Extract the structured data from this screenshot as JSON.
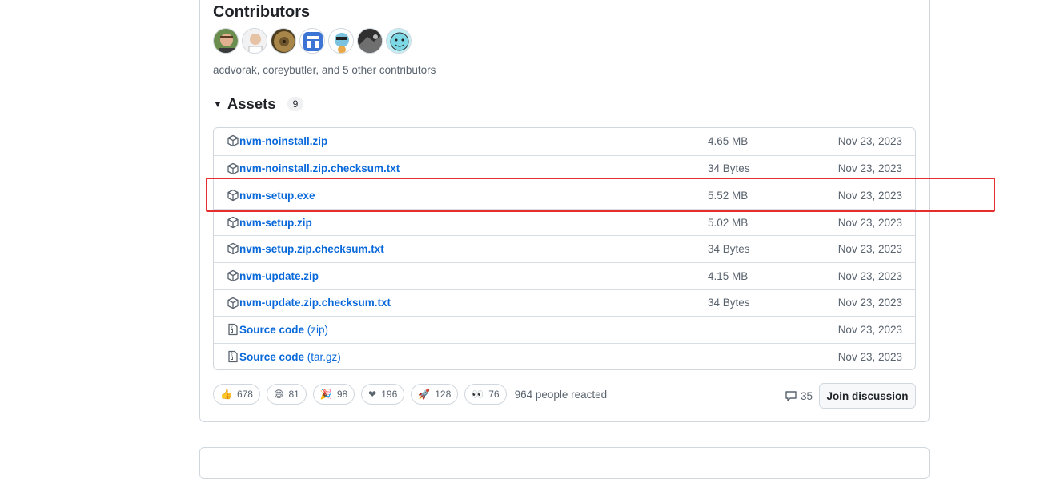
{
  "contributors": {
    "title": "Contributors",
    "text": "acdvorak, coreybutler, and 5 other contributors",
    "avatars": [
      {
        "name": "acdvorak"
      },
      {
        "name": "coreybutler"
      },
      {
        "name": "contributor-3"
      },
      {
        "name": "contributor-4"
      },
      {
        "name": "contributor-5"
      },
      {
        "name": "contributor-6"
      },
      {
        "name": "contributor-7"
      }
    ]
  },
  "assets": {
    "title": "Assets",
    "count": "9",
    "rows": [
      {
        "name": "nvm-noinstall.zip",
        "suffix": "",
        "size": "4.65 MB",
        "date": "Nov 23, 2023",
        "icon": "package-icon"
      },
      {
        "name": "nvm-noinstall.zip.checksum.txt",
        "suffix": "",
        "size": "34 Bytes",
        "date": "Nov 23, 2023",
        "icon": "package-icon"
      },
      {
        "name": "nvm-setup.exe",
        "suffix": "",
        "size": "5.52 MB",
        "date": "Nov 23, 2023",
        "icon": "package-icon"
      },
      {
        "name": "nvm-setup.zip",
        "suffix": "",
        "size": "5.02 MB",
        "date": "Nov 23, 2023",
        "icon": "package-icon"
      },
      {
        "name": "nvm-setup.zip.checksum.txt",
        "suffix": "",
        "size": "34 Bytes",
        "date": "Nov 23, 2023",
        "icon": "package-icon"
      },
      {
        "name": "nvm-update.zip",
        "suffix": "",
        "size": "4.15 MB",
        "date": "Nov 23, 2023",
        "icon": "package-icon"
      },
      {
        "name": "nvm-update.zip.checksum.txt",
        "suffix": "",
        "size": "34 Bytes",
        "date": "Nov 23, 2023",
        "icon": "package-icon"
      },
      {
        "name": "Source code",
        "suffix": " (zip)",
        "size": "",
        "date": "Nov 23, 2023",
        "icon": "file-zip-icon"
      },
      {
        "name": "Source code",
        "suffix": " (tar.gz)",
        "size": "",
        "date": "Nov 23, 2023",
        "icon": "file-zip-icon"
      }
    ]
  },
  "reactions": [
    {
      "emoji": "👍",
      "count": "678",
      "icon": "thumbs-up-icon"
    },
    {
      "emoji": "😄",
      "count": "81",
      "icon": "laugh-icon"
    },
    {
      "emoji": "🎉",
      "count": "98",
      "icon": "hooray-icon"
    },
    {
      "emoji": "❤",
      "count": "196",
      "icon": "heart-icon"
    },
    {
      "emoji": "🚀",
      "count": "128",
      "icon": "rocket-icon"
    },
    {
      "emoji": "👀",
      "count": "76",
      "icon": "eyes-icon"
    }
  ],
  "reacted_text": "964 people reacted",
  "comments_count": "35",
  "join_label": "Join discussion",
  "colors": {
    "link": "#0969da",
    "highlight": "#e62e2e",
    "border": "#d0d7de"
  }
}
